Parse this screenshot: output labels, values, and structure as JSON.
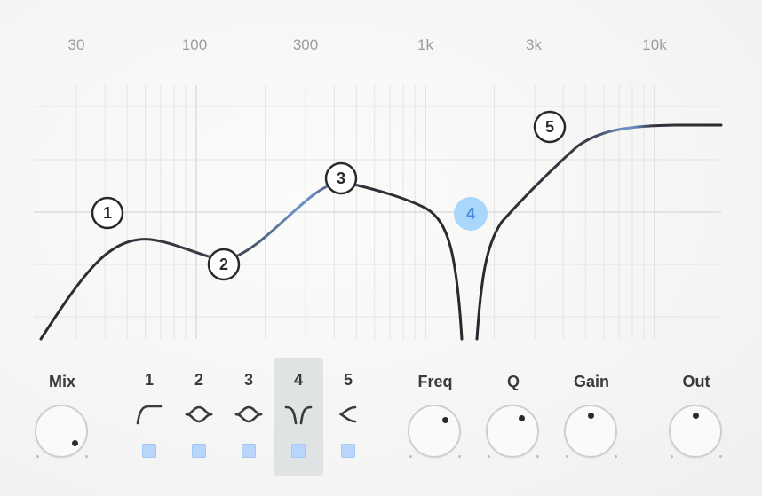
{
  "graph": {
    "freq_labels": [
      "30",
      "100",
      "300",
      "1k",
      "3k",
      "10k"
    ],
    "nodes": [
      {
        "label": "1",
        "active": false
      },
      {
        "label": "2",
        "active": false
      },
      {
        "label": "3",
        "active": false
      },
      {
        "label": "4",
        "active": true
      },
      {
        "label": "5",
        "active": false
      }
    ],
    "curve_color": "#27292e",
    "curve_active_color": "#6b8fc4",
    "active_color": "#a9d6fb"
  },
  "controls": {
    "mix_label": "Mix",
    "freq_label": "Freq",
    "q_label": "Q",
    "gain_label": "Gain",
    "out_label": "Out"
  },
  "bands": [
    {
      "label": "1",
      "shape": "high-pass-icon",
      "active": false
    },
    {
      "label": "2",
      "shape": "bell-icon",
      "active": false
    },
    {
      "label": "3",
      "shape": "bell-icon",
      "active": false
    },
    {
      "label": "4",
      "shape": "notch-icon",
      "active": true
    },
    {
      "label": "5",
      "shape": "high-shelf-icon",
      "active": false
    }
  ],
  "accent": "#b8d6fb"
}
